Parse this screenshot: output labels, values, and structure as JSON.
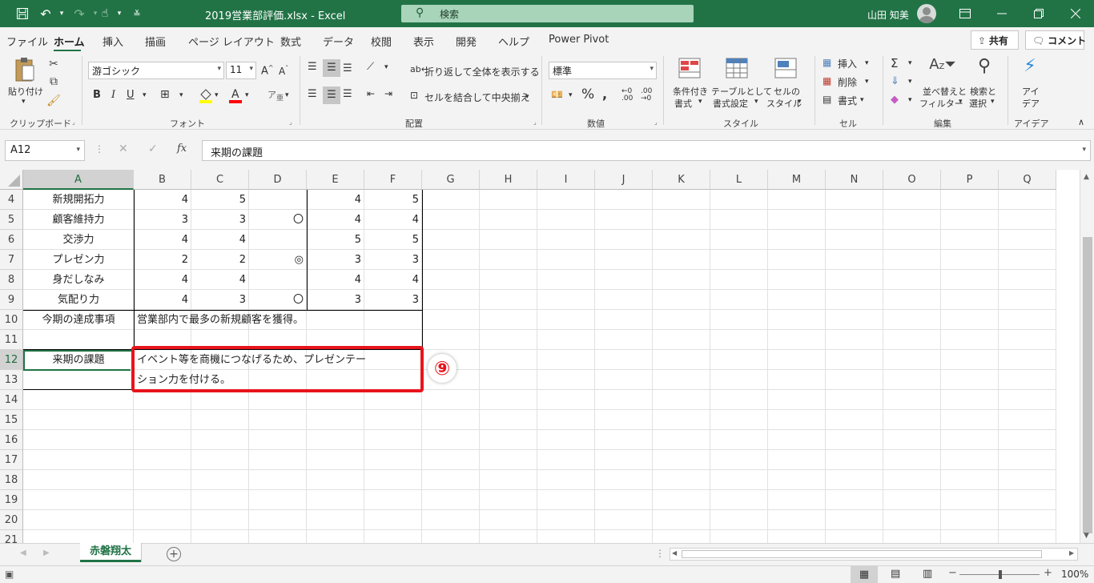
{
  "titlebar": {
    "title": "2019営業部評価.xlsx  -  Excel",
    "search_placeholder": "検索",
    "user_name": "山田 知美"
  },
  "tabs": [
    "ファイル",
    "ホーム",
    "挿入",
    "描画",
    "ページ レイアウト",
    "数式",
    "データ",
    "校閲",
    "表示",
    "開発",
    "ヘルプ",
    "Power Pivot"
  ],
  "share_label": "共有",
  "comment_label": "コメント",
  "ribbon": {
    "clipboard": {
      "paste": "貼り付け",
      "label": "クリップボード"
    },
    "font": {
      "name": "游ゴシック",
      "size": "11",
      "label": "フォント"
    },
    "alignment": {
      "wrap": "折り返して全体を表示する",
      "merge": "セルを結合して中央揃え",
      "label": "配置"
    },
    "number": {
      "format": "標準",
      "label": "数値"
    },
    "styles": {
      "conditional1": "条件付き",
      "conditional2": "書式",
      "table1": "テーブルとして",
      "table2": "書式設定",
      "cell1": "セルの",
      "cell2": "スタイル",
      "label": "スタイル"
    },
    "cells": {
      "insert": "挿入",
      "delete": "削除",
      "format": "書式",
      "label": "セル"
    },
    "editing": {
      "sort1": "並べ替えと",
      "sort2": "フィルター",
      "find1": "検索と",
      "find2": "選択",
      "label": "編集"
    },
    "ideas": {
      "idea1": "アイ",
      "idea2": "デア",
      "label": "アイデア"
    }
  },
  "formula_bar": {
    "name_box": "A12",
    "content": "来期の課題"
  },
  "columns": [
    "A",
    "B",
    "C",
    "D",
    "E",
    "F",
    "G",
    "H",
    "I",
    "J",
    "K",
    "L",
    "M",
    "N",
    "O",
    "P",
    "Q"
  ],
  "rows": [
    4,
    5,
    6,
    7,
    8,
    9,
    10,
    11,
    12,
    13,
    14,
    15,
    16,
    17,
    18,
    19,
    20,
    21
  ],
  "data_rows": [
    {
      "label": "新規開拓力",
      "b": "4",
      "c": "5",
      "d": "",
      "e": "4",
      "f": "5"
    },
    {
      "label": "顧客維持力",
      "b": "3",
      "c": "3",
      "d": "〇",
      "e": "4",
      "f": "4"
    },
    {
      "label": "交渉力",
      "b": "4",
      "c": "4",
      "d": "",
      "e": "5",
      "f": "5"
    },
    {
      "label": "プレゼン力",
      "b": "2",
      "c": "2",
      "d": "◎",
      "e": "3",
      "f": "3"
    },
    {
      "label": "身だしなみ",
      "b": "4",
      "c": "4",
      "d": "",
      "e": "4",
      "f": "4"
    },
    {
      "label": "気配り力",
      "b": "4",
      "c": "3",
      "d": "〇",
      "e": "3",
      "f": "3"
    }
  ],
  "achievement_label": "今期の達成事項",
  "achievement_text": "営業部内で最多の新規顧客を獲得。",
  "issue_label": "来期の課題",
  "issue_line1": "イベント等を商機につなげるため、プレゼンテー",
  "issue_line2": "ション力を付ける。",
  "step_marker": "⑨",
  "highlight_color": "#e8141c",
  "sheet_tab": "赤磐翔太",
  "zoom": "100%",
  "accent_color": "#217346"
}
